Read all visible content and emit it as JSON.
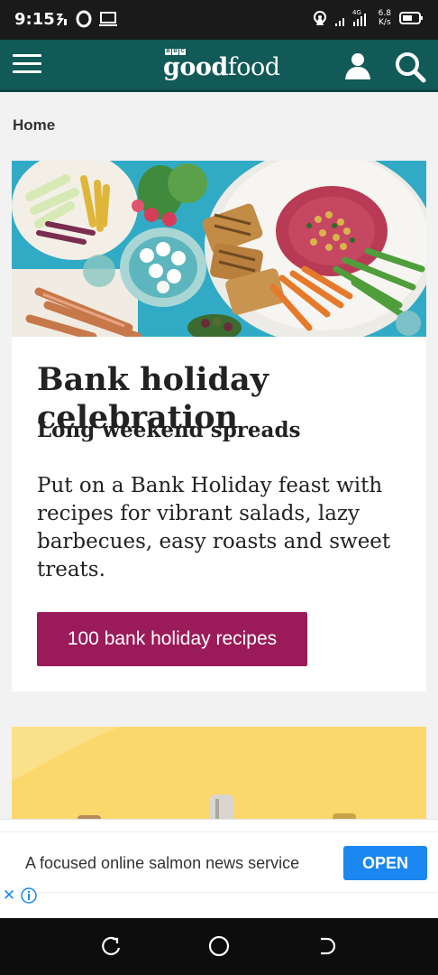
{
  "status_bar": {
    "time": "9:15",
    "net_speed_value": "6.8",
    "net_speed_unit": "K/s",
    "network_type": "4G",
    "icons": [
      "notification-icon",
      "opera-icon",
      "screen-icon",
      "hotspot-icon",
      "signal-icon",
      "battery-icon"
    ]
  },
  "header": {
    "logo_bbc": [
      "B",
      "B",
      "C"
    ],
    "logo_good": "good",
    "logo_food": "food",
    "icons": [
      "menu-icon",
      "user-icon",
      "search-icon"
    ],
    "background_color": "#115a58"
  },
  "breadcrumb": "Home",
  "feature_card": {
    "title": "Bank holiday celebration",
    "subtitle": "Long weekend spreads",
    "description": "Put on a Bank Holiday feast with recipes for vibrant salads, lazy barbecues, easy roasts and sweet treats.",
    "button_label": "100 bank holiday recipes",
    "button_color": "#9b1b5a"
  },
  "ad": {
    "text": "A focused online salmon news service",
    "open_label": "OPEN",
    "close_symbol": "✕",
    "open_color": "#1a88f0"
  },
  "nav_bar": {
    "icons": [
      "recents-icon",
      "home-icon",
      "back-icon"
    ]
  }
}
